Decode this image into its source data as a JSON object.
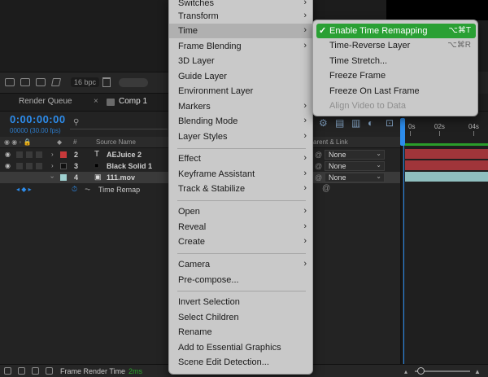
{
  "project_toolbar": {
    "bpc": "16 bpc"
  },
  "tabs": {
    "render_queue": "Render Queue",
    "close_glyph": "×",
    "comp": "Comp 1"
  },
  "comp": {
    "timecode": "0:00:00:00",
    "fps": "00000 (30.00 fps)",
    "search_glyph": "⚲"
  },
  "columns": {
    "number": "#",
    "source_name": "Source Name",
    "parent_link": "arent & Link"
  },
  "layers": [
    {
      "num": "2",
      "type_glyph": "T",
      "name": "AEJuice 2",
      "parent": "None",
      "label_color": "#c8393a",
      "bar_color": "#a0353a"
    },
    {
      "num": "3",
      "type_glyph": "■",
      "name": "Black Solid 1",
      "parent": "None",
      "label_color": "#111111",
      "bar_color": "#a0353a"
    },
    {
      "num": "4",
      "type_glyph": "▣",
      "name": "111.mov",
      "parent": "None",
      "label_color": "#9fd0d0",
      "bar_color": "#8fbfbf"
    }
  ],
  "sub_property": {
    "name": "Time Remap",
    "kf_glyph": "◂ ◆ ▸",
    "r_glyph": "⏱",
    "g_glyph": "⏦",
    "swirl": "@"
  },
  "timeline": {
    "ruler": [
      "0s",
      "02s",
      "04s"
    ]
  },
  "statusbar": {
    "label": "Frame Render Time",
    "value": "2ms"
  },
  "context_menu": {
    "items": [
      {
        "label": "Switches",
        "arrow": true
      },
      {
        "label": "Transform",
        "arrow": true
      },
      {
        "label": "Time",
        "arrow": true,
        "active": true
      },
      {
        "label": "Frame Blending",
        "arrow": true
      },
      {
        "label": "3D Layer"
      },
      {
        "label": "Guide Layer"
      },
      {
        "label": "Environment Layer"
      },
      {
        "label": "Markers",
        "arrow": true
      },
      {
        "label": "Blending Mode",
        "arrow": true
      },
      {
        "label": "Layer Styles",
        "arrow": true
      },
      {
        "label": "Effect",
        "arrow": true
      },
      {
        "label": "Keyframe Assistant",
        "arrow": true
      },
      {
        "label": "Track & Stabilize",
        "arrow": true
      },
      {
        "label": "Open",
        "arrow": true
      },
      {
        "label": "Reveal",
        "arrow": true
      },
      {
        "label": "Create",
        "arrow": true
      },
      {
        "label": "Camera",
        "arrow": true
      },
      {
        "label": "Pre-compose..."
      },
      {
        "label": "Invert Selection"
      },
      {
        "label": "Select Children"
      },
      {
        "label": "Rename"
      },
      {
        "label": "Add to Essential Graphics"
      },
      {
        "label": "Scene Edit Detection..."
      }
    ],
    "arrow_glyph": "›"
  },
  "time_submenu": {
    "items": [
      {
        "label": "Enable Time Remapping",
        "shortcut": "⌥⌘T",
        "check": "✓",
        "highlight": true
      },
      {
        "label": "Time-Reverse Layer",
        "shortcut": "⌥⌘R"
      },
      {
        "label": "Time Stretch..."
      },
      {
        "label": "Freeze Frame"
      },
      {
        "label": "Freeze On Last Frame"
      },
      {
        "label": "Align Video to Data",
        "disabled": true
      }
    ]
  },
  "colors": {
    "accent_blue": "#2d8ceb",
    "highlight_green": "#2aa034",
    "status_green": "#2aa52a"
  }
}
